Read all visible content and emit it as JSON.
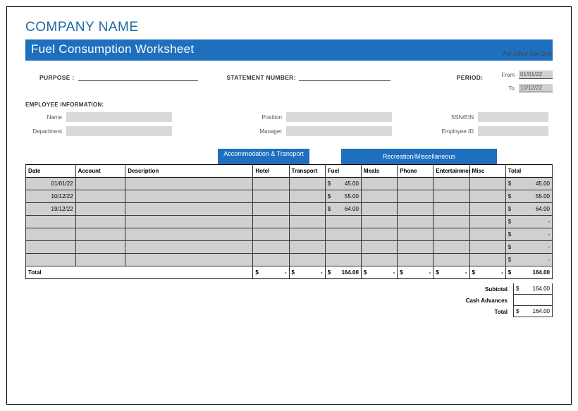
{
  "header": {
    "company": "COMPANY NAME",
    "office_use": "For Office Use Only",
    "title": "Fuel Consumption Worksheet"
  },
  "meta": {
    "purpose_label": "PURPOSE :",
    "purpose_value": "",
    "statement_label": "STATEMENT NUMBER:",
    "statement_value": "",
    "period_label": "PERIOD:",
    "from_label": "From",
    "from_value": "01/01/22",
    "to_label": "To",
    "to_value": "10/12/22"
  },
  "employee": {
    "section": "EMPLOYEE INFORMATION:",
    "name_label": "Name",
    "name_value": "",
    "position_label": "Position",
    "position_value": "",
    "ssn_label": "SSN/EIN",
    "ssn_value": "",
    "department_label": "Department",
    "department_value": "",
    "manager_label": "Manager",
    "manager_value": "",
    "empid_label": "Employee ID",
    "empid_value": ""
  },
  "categories": {
    "accommodation": "Accommodation & Transport",
    "recreation": "Recreation/Miscellaneous"
  },
  "columns": {
    "date": "Date",
    "account": "Account",
    "description": "Description",
    "hotel": "Hotel",
    "transport": "Transport",
    "fuel": "Fuel",
    "meals": "Meals",
    "phone": "Phone",
    "entertainment": "Entertainment",
    "misc": "Misc",
    "total": "Total"
  },
  "currency": "$",
  "rows": [
    {
      "date": "01/01/22",
      "fuel": "45.00",
      "total": "45.00"
    },
    {
      "date": "10/12/22",
      "fuel": "55.00",
      "total": "55.00"
    },
    {
      "date": "19/12/22",
      "fuel": "64.00",
      "total": "64.00"
    },
    {
      "date": "",
      "fuel": "",
      "total": "-"
    },
    {
      "date": "",
      "fuel": "",
      "total": "-"
    },
    {
      "date": "",
      "fuel": "",
      "total": "-"
    },
    {
      "date": "",
      "fuel": "",
      "total": "-"
    }
  ],
  "totals_row": {
    "label": "Total",
    "hotel": "-",
    "transport": "-",
    "fuel": "164.00",
    "meals": "-",
    "phone": "-",
    "entertainment": "-",
    "misc": "-",
    "total": "164.00"
  },
  "summary": {
    "subtotal_label": "Subtotal",
    "subtotal": "164.00",
    "cash_label": "Cash Advances",
    "cash": "",
    "total_label": "Total",
    "total": "164.00"
  }
}
